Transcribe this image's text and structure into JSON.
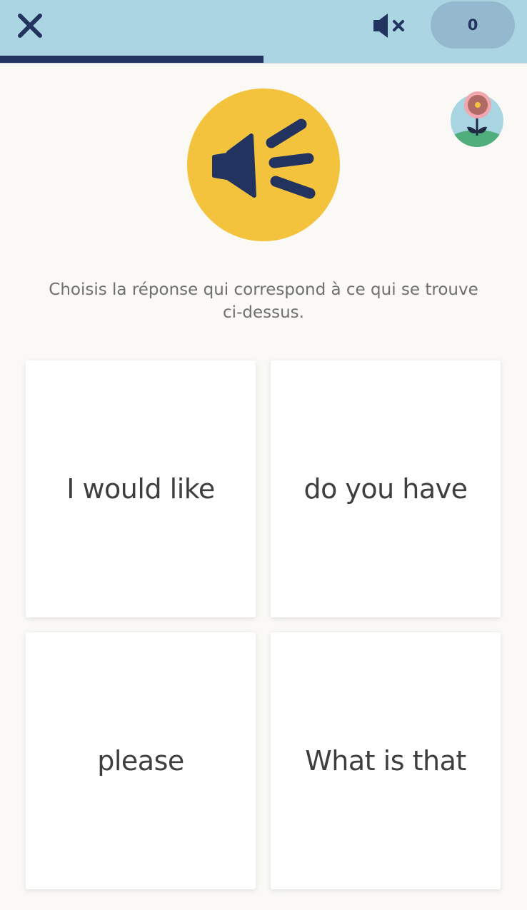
{
  "header": {
    "close_icon": "close-icon",
    "mute_icon": "speaker-muted-icon",
    "score": "0",
    "progress": 0.5
  },
  "prompt": {
    "audio_icon": "speaker-icon",
    "instruction": "Choisis la réponse qui correspond à ce qui se trouve ci-dessus."
  },
  "avatar": {
    "icon": "flower-avatar-icon"
  },
  "options": [
    {
      "label": "I would like"
    },
    {
      "label": "do you have"
    },
    {
      "label": "please"
    },
    {
      "label": "What is that"
    }
  ],
  "colors": {
    "topbar": "#acd5e4",
    "navy": "#23335f",
    "score_pill": "#94b8cd",
    "audio_circle": "#f4c33d",
    "background": "#faf9f5"
  }
}
